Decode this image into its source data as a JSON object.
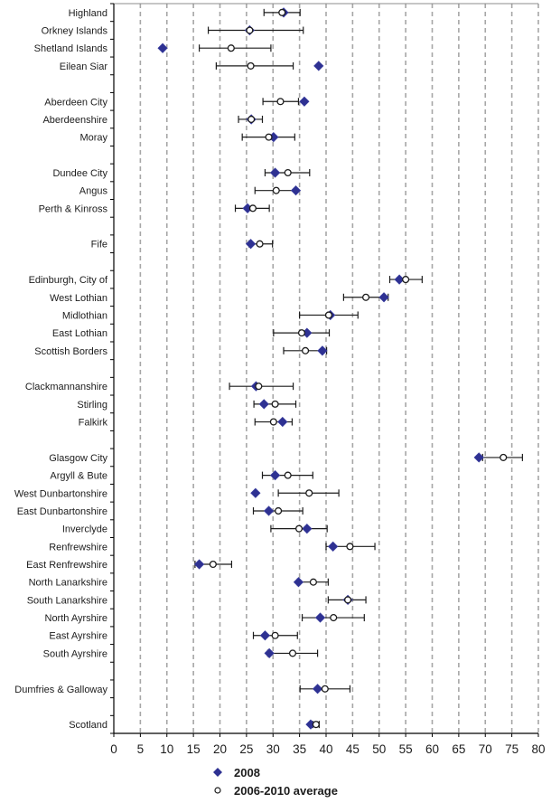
{
  "chart_data": {
    "type": "scatter",
    "title": "",
    "xlabel": "",
    "ylabel": "",
    "xlim": [
      0,
      80
    ],
    "x_ticks": [
      0,
      5,
      10,
      15,
      20,
      25,
      30,
      35,
      40,
      45,
      50,
      55,
      60,
      65,
      70,
      75,
      80
    ],
    "x_tick_labels": [
      "0",
      "5",
      "10",
      "15",
      "20",
      "25",
      "30",
      "35",
      "40",
      "45",
      "50",
      "55",
      "60",
      "65",
      "70",
      "75",
      "80"
    ],
    "grid": "vertical-dashed",
    "legend_position": "bottom-center",
    "colors": {
      "marker_2008": "#2e3192",
      "marker_avg_fill": "#ffffff",
      "marker_avg_stroke": "#1c1c1c",
      "grid": "#a6a6a6",
      "axis": "#000000",
      "error_bar": "#1c1c1c"
    },
    "series": [
      {
        "name": "2008",
        "marker": "diamond"
      },
      {
        "name": "2006-2010 average",
        "marker": "circle",
        "error_bars": true
      }
    ],
    "legend": [
      {
        "label": "2008",
        "marker": "diamond"
      },
      {
        "label": "2006-2010 average",
        "marker": "circle"
      }
    ],
    "rows": [
      {
        "label": "Highland",
        "v2008": 32.0,
        "avg": 31.7,
        "low": 28.3,
        "high": 35.1
      },
      {
        "label": "Orkney Islands",
        "v2008": 25.6,
        "avg": 25.6,
        "low": 17.8,
        "high": 35.7
      },
      {
        "label": "Shetland Islands",
        "v2008": 9.2,
        "avg": 22.1,
        "low": 16.1,
        "high": 29.6
      },
      {
        "label": "Eilean Siar",
        "v2008": 38.6,
        "avg": 25.8,
        "low": 19.3,
        "high": 33.8
      },
      {
        "label": ""
      },
      {
        "label": "Aberdeen City",
        "v2008": 35.9,
        "avg": 31.4,
        "low": 28.1,
        "high": 34.8
      },
      {
        "label": "Aberdeenshire",
        "v2008": 25.9,
        "avg": 25.9,
        "low": 23.5,
        "high": 28.0
      },
      {
        "label": "Moray",
        "v2008": 30.1,
        "avg": 29.2,
        "low": 24.2,
        "high": 34.1
      },
      {
        "label": ""
      },
      {
        "label": "Dundee City",
        "v2008": 30.4,
        "avg": 32.8,
        "low": 28.5,
        "high": 36.9
      },
      {
        "label": "Angus",
        "v2008": 34.3,
        "avg": 30.6,
        "low": 26.6,
        "high": 34.4
      },
      {
        "label": "Perth & Kinross",
        "v2008": 25.2,
        "avg": 26.2,
        "low": 22.9,
        "high": 29.3
      },
      {
        "label": ""
      },
      {
        "label": "Fife",
        "v2008": 25.8,
        "avg": 27.5,
        "low": 25.5,
        "high": 29.9
      },
      {
        "label": ""
      },
      {
        "label": "Edinburgh, City of",
        "v2008": 53.8,
        "avg": 55.0,
        "low": 52.0,
        "high": 58.1
      },
      {
        "label": "West Lothian",
        "v2008": 50.9,
        "avg": 47.5,
        "low": 43.3,
        "high": 51.7
      },
      {
        "label": "Midlothian",
        "v2008": 40.8,
        "avg": 40.5,
        "low": 35.0,
        "high": 46.0
      },
      {
        "label": "East Lothian",
        "v2008": 36.4,
        "avg": 35.4,
        "low": 30.1,
        "high": 40.6
      },
      {
        "label": "Scottish Borders",
        "v2008": 39.3,
        "avg": 36.1,
        "low": 32.0,
        "high": 40.1
      },
      {
        "label": ""
      },
      {
        "label": "Clackmannanshire",
        "v2008": 26.8,
        "avg": 27.3,
        "low": 21.8,
        "high": 33.8
      },
      {
        "label": "Stirling",
        "v2008": 28.3,
        "avg": 30.4,
        "low": 26.4,
        "high": 34.3
      },
      {
        "label": "Falkirk",
        "v2008": 31.8,
        "avg": 30.1,
        "low": 26.6,
        "high": 33.6
      },
      {
        "label": ""
      },
      {
        "label": "Glasgow City",
        "v2008": 68.8,
        "avg": 73.4,
        "low": 69.5,
        "high": 77.0
      },
      {
        "label": "Argyll & Bute",
        "v2008": 30.4,
        "avg": 32.8,
        "low": 28.0,
        "high": 37.5
      },
      {
        "label": "West Dunbartonshire",
        "v2008": 26.7,
        "avg": 36.8,
        "low": 31.0,
        "high": 42.4
      },
      {
        "label": "East Dunbartonshire",
        "v2008": 29.2,
        "avg": 31.0,
        "low": 26.3,
        "high": 35.6
      },
      {
        "label": "Inverclyde",
        "v2008": 36.4,
        "avg": 34.9,
        "low": 29.6,
        "high": 40.2
      },
      {
        "label": "Renfrewshire",
        "v2008": 41.3,
        "avg": 44.5,
        "low": 40.0,
        "high": 49.2
      },
      {
        "label": "East Renfrewshire",
        "v2008": 16.1,
        "avg": 18.7,
        "low": 15.3,
        "high": 22.2
      },
      {
        "label": "North Lanarkshire",
        "v2008": 34.8,
        "avg": 37.6,
        "low": 34.6,
        "high": 40.4
      },
      {
        "label": "South Lanarkshire",
        "v2008": 44.1,
        "avg": 44.1,
        "low": 40.4,
        "high": 47.5
      },
      {
        "label": "North Ayrshire",
        "v2008": 38.9,
        "avg": 41.4,
        "low": 35.5,
        "high": 47.2
      },
      {
        "label": "East Ayrshire",
        "v2008": 28.5,
        "avg": 30.4,
        "low": 26.3,
        "high": 34.6
      },
      {
        "label": "South Ayrshire",
        "v2008": 29.3,
        "avg": 33.7,
        "low": 29.0,
        "high": 38.4
      },
      {
        "label": ""
      },
      {
        "label": "Dumfries & Galloway",
        "v2008": 38.4,
        "avg": 39.8,
        "low": 35.1,
        "high": 44.5
      },
      {
        "label": ""
      },
      {
        "label": "Scotland",
        "v2008": 37.1,
        "avg": 38.1,
        "low": 37.5,
        "high": 38.7
      }
    ]
  }
}
